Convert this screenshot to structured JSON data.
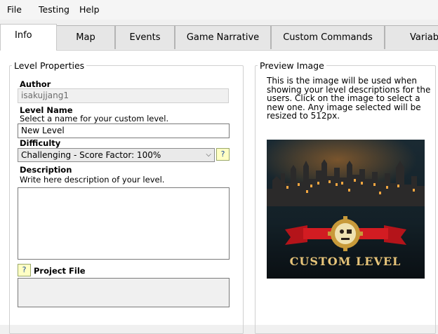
{
  "menu": [
    "File",
    "Testing",
    "Help"
  ],
  "tabs": [
    "Info",
    "Map",
    "Events",
    "Game Narrative",
    "Custom Commands",
    "Variables"
  ],
  "level_properties": {
    "legend": "Level Properties",
    "author_label": "Author",
    "author_value": "isakujjang1",
    "level_name_label": "Level Name",
    "level_name_hint": "Select a name for your custom level.",
    "level_name_value": "New Level",
    "difficulty_label": "Difficulty",
    "difficulty_value": "Challenging - Score Factor: 100%",
    "help_glyph": "?",
    "description_label": "Description",
    "description_hint": "Write here description of your level.",
    "description_value": "",
    "project_file_label": "Project File",
    "project_file_value": ""
  },
  "preview": {
    "legend": "Preview Image",
    "text_lines": [
      "This is the image will be used when",
      "showing your level descriptions for the",
      "users. Click on the image to select a",
      "new one. Any image selected will be",
      "resized to 512px."
    ],
    "image_title": "CUSTOM LEVEL"
  }
}
